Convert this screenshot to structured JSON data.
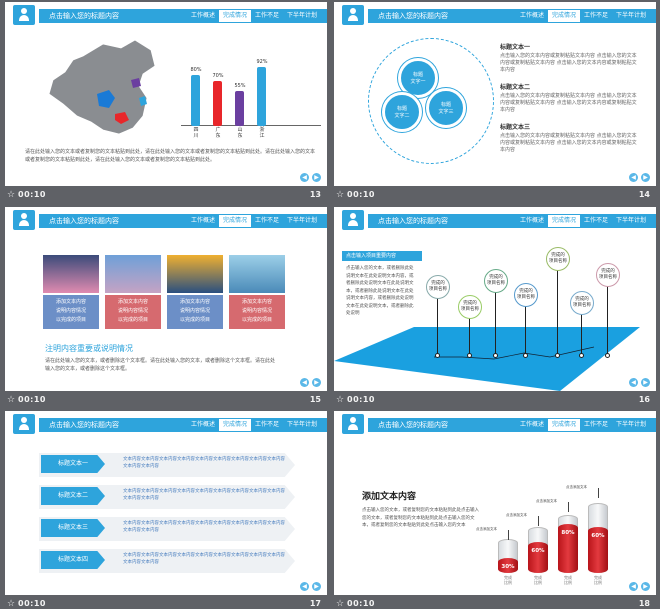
{
  "header": {
    "title": "点击输入您的标题内容",
    "tabs": [
      "工作概述",
      "完成情况",
      "工作不足",
      "下半年计划"
    ]
  },
  "common": {
    "time": "00:10",
    "nav_prev": "◀",
    "nav_next": "▶",
    "star": "☆"
  },
  "slides": [
    {
      "number": "13",
      "bars": [
        {
          "label": "四\n川",
          "pct": "80%",
          "color": "#2ea4dc"
        },
        {
          "label": "广\n东",
          "pct": "70%",
          "color": "#e8262a"
        },
        {
          "label": "山\n东",
          "pct": "55%",
          "color": "#6b3fa0"
        },
        {
          "label": "浙\n江",
          "pct": "92%",
          "color": "#2ea4dc"
        }
      ],
      "body": "请在此处输入您的文本或者复制您的文本粘贴到此处，请在此处输入您的文本或者复制您的文本粘贴到此处。请在此处输入您的文本或者复制您的文本粘贴到此处，请在此处输入您的文本或者复制您的文本粘贴到此处。"
    },
    {
      "number": "14",
      "circles": [
        "标题\n文字一",
        "标题\n文字二",
        "标题\n文字三"
      ],
      "items": [
        {
          "title": "标题文本一",
          "text": "点击输入您的文本内容或复制粘贴文本内容 点击输入您的文本内容或复制粘贴文本内容 点击输入您的文本内容或复制粘贴文本内容"
        },
        {
          "title": "标题文本二",
          "text": "点击输入您的文本内容或复制粘贴文本内容 点击输入您的文本内容或复制粘贴文本内容 点击输入您的文本内容或复制粘贴文本内容"
        },
        {
          "title": "标题文本三",
          "text": "点击输入您的文本内容或复制粘贴文本内容 点击输入您的文本内容或复制粘贴文本内容 点击输入您的文本内容或复制粘贴文本内容"
        }
      ]
    },
    {
      "number": "15",
      "cards": [
        {
          "text": "添加文本内容\n说明内容情况\n以完成的项目",
          "color": "#6c8fc7"
        },
        {
          "text": "添加文本内容\n说明内容情况\n以完成的项目",
          "color": "#d66a6f"
        },
        {
          "text": "添加文本内容\n说明内容情况\n以完成的项目",
          "color": "#6c8fc7"
        },
        {
          "text": "添加文本内容\n说明内容情况\n以完成的项目",
          "color": "#d66a6f"
        }
      ],
      "heading": "注明内容重要或说明情况",
      "body": "请在此处输入您的文本，或者删除这个文本框。请在此处输入您的文本，或者删除这个文本框。请在此处输入您的文本，或者删除这个文本框。"
    },
    {
      "number": "16",
      "banner": "点击输入项目重要内容",
      "body": "点击输入您的文本，或者删除此处说明文本在此处说明文本内容，或者删除此处说明文本在此处说明文本，或者删除此处说明文本在此处说明文本内容，或者删除此处说明文本在此处说明文本，或者删除此处说明",
      "pins": [
        "完成的\n项目名称",
        "完成的\n项目名称",
        "完成的\n项目名称",
        "完成的\n项目名称",
        "完成的\n项目名称",
        "完成的\n项目名称",
        "完成的\n项目名称"
      ]
    },
    {
      "number": "17",
      "rows": [
        {
          "label": "标题文本一",
          "text": "文本内容文本内容文本内容文本内容文本内容文本内容文本内容文本内容文本内容文本内容文本内容"
        },
        {
          "label": "标题文本二",
          "text": "文本内容文本内容文本内容文本内容文本内容文本内容文本内容文本内容文本内容文本内容文本内容"
        },
        {
          "label": "标题文本三",
          "text": "文本内容文本内容文本内容文本内容文本内容文本内容文本内容文本内容文本内容文本内容文本内容"
        },
        {
          "label": "标题文本四",
          "text": "文本内容文本内容文本内容文本内容文本内容文本内容文本内容文本内容文本内容文本内容文本内容"
        }
      ]
    },
    {
      "number": "18",
      "heading": "添加文本内容",
      "body": "点击输入您的文本，或者复制您的文本粘贴到此处点击输入您的文本，或者复制您的文本粘贴到此处点击输入您的文本，或者复制您的文本粘贴到此处点击输入您的文本",
      "cylinders": [
        {
          "pct": "30%",
          "fill": 0.3,
          "caption": "完成\n比例",
          "note": "点击添加文本"
        },
        {
          "pct": "60%",
          "fill": 0.6,
          "caption": "完成\n比例",
          "note": "点击添加文本"
        },
        {
          "pct": "80%",
          "fill": 0.8,
          "caption": "完成\n比例",
          "note": "点击添加文本"
        },
        {
          "pct": "60%",
          "fill": 0.6,
          "caption": "完成\n比例",
          "note": "点击添加文本"
        }
      ]
    }
  ]
}
